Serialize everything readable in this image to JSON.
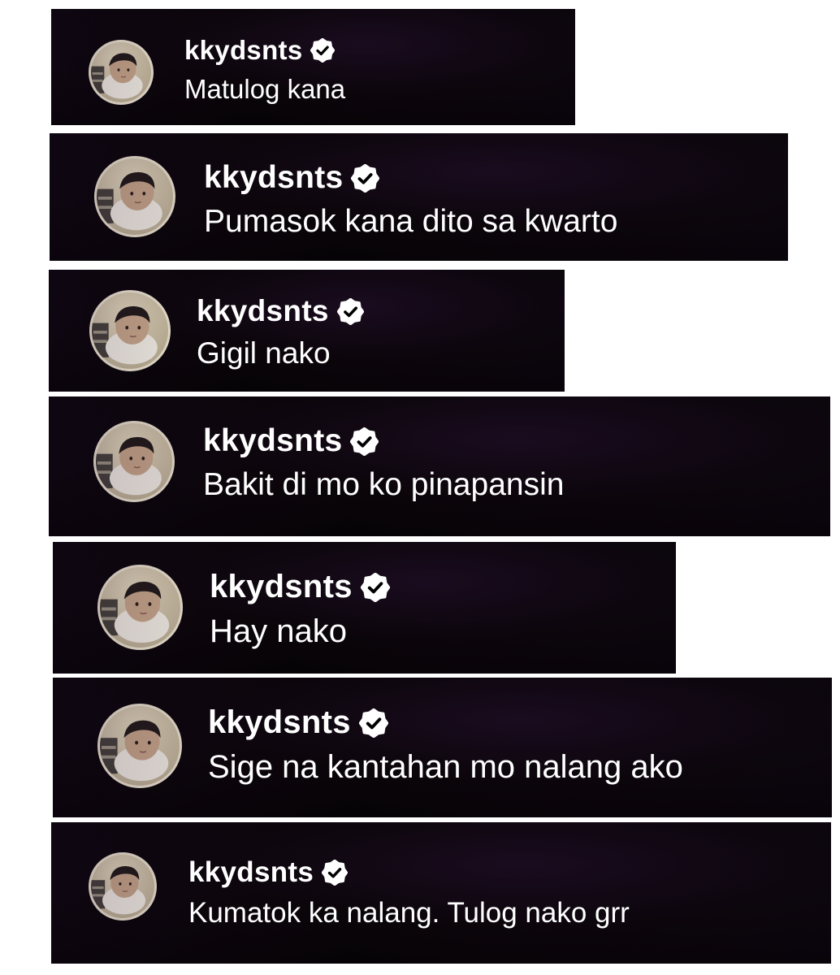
{
  "comments": [
    {
      "username": "kkydsnts",
      "text": "Matulog kana",
      "verified_icon": "verified-badge-icon"
    },
    {
      "username": "kkydsnts",
      "text": "Pumasok kana dito sa kwarto",
      "verified_icon": "verified-badge-icon"
    },
    {
      "username": "kkydsnts",
      "text": "Gigil nako",
      "verified_icon": "verified-badge-icon"
    },
    {
      "username": "kkydsnts",
      "text": "Bakit di mo ko pinapansin",
      "verified_icon": "verified-badge-icon"
    },
    {
      "username": "kkydsnts",
      "text": "Hay nako",
      "verified_icon": "verified-badge-icon"
    },
    {
      "username": "kkydsnts",
      "text": "Sige na kantahan mo nalang ako",
      "verified_icon": "verified-badge-icon"
    },
    {
      "username": "kkydsnts",
      "text": "Kumatok ka nalang. Tulog nako grr",
      "verified_icon": "verified-badge-icon"
    }
  ],
  "colors": {
    "background": "#ffffff",
    "comment_bg": "#050205",
    "text": "#ffffff",
    "badge": "#ffffff"
  }
}
